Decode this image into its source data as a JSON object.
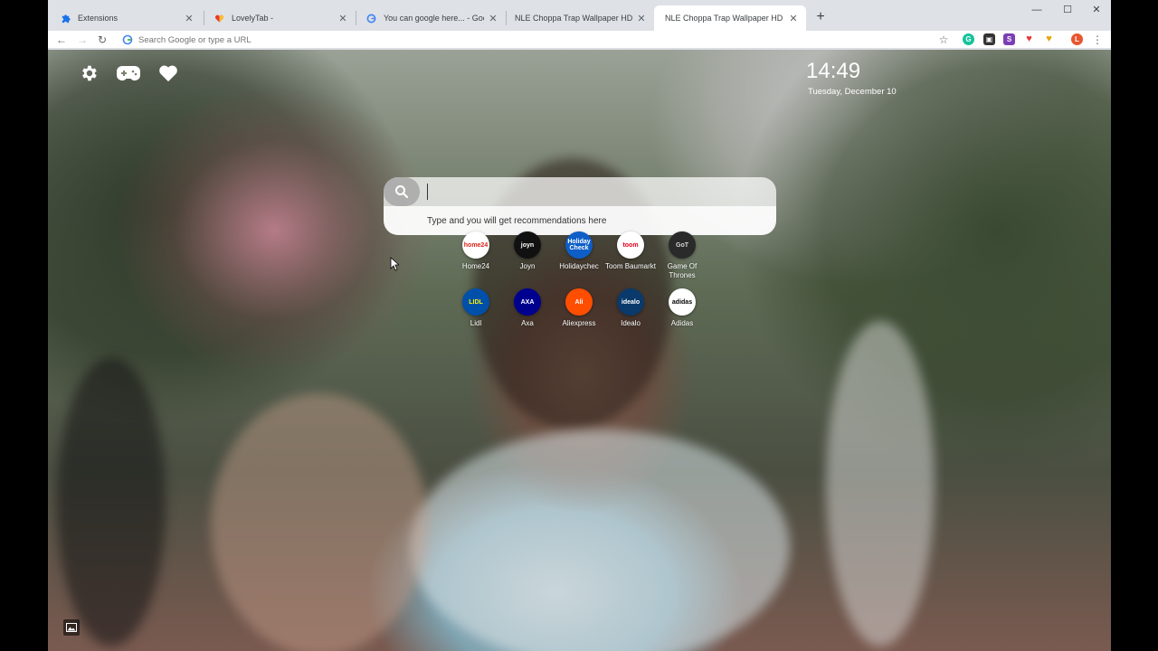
{
  "tabs": [
    {
      "title": "Extensions",
      "favicon": "puzzle-icon",
      "color": "#1a73e8",
      "active": false
    },
    {
      "title": "LovelyTab -",
      "favicon": "heart-icon",
      "color": "#e53935",
      "active": false
    },
    {
      "title": "You can google here... - Google",
      "favicon": "google-icon",
      "color": "#4285f4",
      "active": false
    },
    {
      "title": "NLE Choppa Trap Wallpaper HD New",
      "favicon": "none",
      "color": "",
      "active": false
    },
    {
      "title": "NLE Choppa Trap Wallpaper HD New",
      "favicon": "none",
      "color": "",
      "active": true
    }
  ],
  "toolbar": {
    "omnibox_placeholder": "Search Google or type a URL"
  },
  "page": {
    "time": "14:49",
    "date": "Tuesday, December 10",
    "search_suggestion": "Type and you will get recommendations here",
    "tiles": [
      {
        "label": "Home24",
        "bg": "#ffffff",
        "fg": "#e2231a",
        "text": "home24"
      },
      {
        "label": "Joyn",
        "bg": "#111111",
        "fg": "#ffffff",
        "text": "joyn"
      },
      {
        "label": "Holidaychec",
        "bg": "#0d5ec7",
        "fg": "#ffffff",
        "text": "Holiday Check"
      },
      {
        "label": "Toom Baumarkt",
        "bg": "#ffffff",
        "fg": "#e2001a",
        "text": "toom"
      },
      {
        "label": "Game Of Thrones",
        "bg": "#2a2a2a",
        "fg": "#d8d8d8",
        "text": "GoT"
      },
      {
        "label": "Lidl",
        "bg": "#0050aa",
        "fg": "#fff000",
        "text": "LIDL"
      },
      {
        "label": "Axa",
        "bg": "#00008f",
        "fg": "#ffffff",
        "text": "AXA"
      },
      {
        "label": "Aliexpress",
        "bg": "#ff4e00",
        "fg": "#ffffff",
        "text": "Ali"
      },
      {
        "label": "Idealo",
        "bg": "#0a3a6b",
        "fg": "#ffffff",
        "text": "idealo"
      },
      {
        "label": "Adidas",
        "bg": "#ffffff",
        "fg": "#000000",
        "text": "adidas"
      }
    ]
  }
}
